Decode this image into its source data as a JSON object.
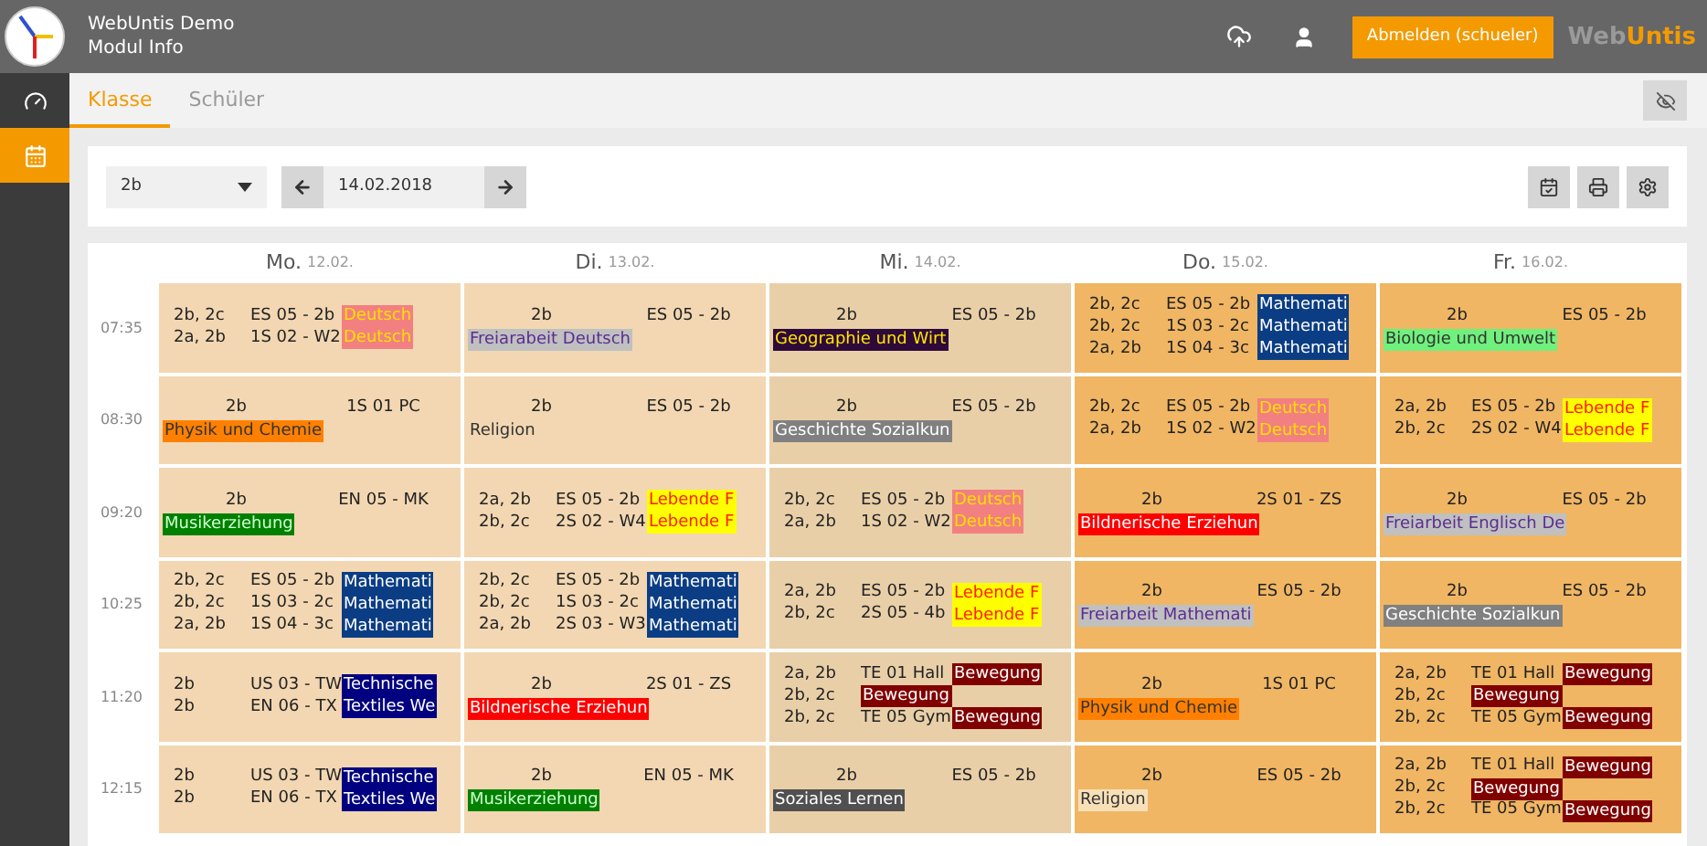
{
  "app": {
    "title": "WebUntis Demo",
    "subtitle": "Modul Info",
    "logout": "Abmelden (schueler)",
    "brand_prefix": "Web",
    "brand_suffix": "Untis"
  },
  "sidebar": [
    {
      "kind": "dashboard",
      "selected": false
    },
    {
      "kind": "calendar",
      "selected": true
    }
  ],
  "tabs": [
    {
      "label": "Klasse",
      "selected": true
    },
    {
      "label": "Schüler",
      "selected": false
    }
  ],
  "toolbar": {
    "class_select": "2b",
    "date": "14.02.2018"
  },
  "days": [
    {
      "name": "Mo.",
      "date": "12.02.",
      "color": "#f2d7b2"
    },
    {
      "name": "Di.",
      "date": "13.02.",
      "color": "#f2d7b2"
    },
    {
      "name": "Mi.",
      "date": "14.02.",
      "color": "#e9cfa8"
    },
    {
      "name": "Do.",
      "date": "15.02.",
      "color": "#f0b664"
    },
    {
      "name": "Fr.",
      "date": "16.02.",
      "color": "#f0b664"
    }
  ],
  "rows": [
    {
      "time": "07:35",
      "cells": [
        {
          "kind": "multi",
          "lines": [
            {
              "class": "2b, 2c",
              "room": "ES 05 - 2b",
              "subject": {
                "text": "Deutsch",
                "color": "#f28080"
              }
            },
            {
              "class": "2a, 2b",
              "room": "1S 02 - W2",
              "subject": {
                "text": "Deutsch",
                "color": "#f28080"
              }
            }
          ]
        },
        {
          "kind": "single",
          "class": "2b",
          "room": "ES 05 - 2b",
          "subject": {
            "text": "Freiarabeit Deutsch",
            "color": "#c0c0c0"
          }
        },
        {
          "kind": "single",
          "class": "2b",
          "room": "ES 05 - 2b",
          "subject": {
            "text": "Geographie und Wirt",
            "color": "#2e0a3a"
          }
        },
        {
          "kind": "multi",
          "lines": [
            {
              "class": "2b, 2c",
              "room": "ES 05 - 2b",
              "subject": {
                "text": "Mathemati",
                "color": "#0b3d84"
              }
            },
            {
              "class": "2b, 2c",
              "room": "1S 03 - 2c",
              "subject": {
                "text": "Mathemati",
                "color": "#0b3d84"
              }
            },
            {
              "class": "2a, 2b",
              "room": "1S 04 - 3c",
              "subject": {
                "text": "Mathemati",
                "color": "#0b3d84"
              }
            }
          ]
        },
        {
          "kind": "single",
          "class": "2b",
          "room": "ES 05 - 2b",
          "subject": {
            "text": "Biologie und Umwelt",
            "color": "#70f07c"
          }
        }
      ]
    },
    {
      "time": "08:30",
      "cells": [
        {
          "kind": "single",
          "class": "2b",
          "room": "1S 01 PC",
          "subject": {
            "text": "Physik und Chemie",
            "color": "#ff8000"
          }
        },
        {
          "kind": "single",
          "class": "2b",
          "room": "ES 05 - 2b",
          "subject": {
            "text": "Religion"
          }
        },
        {
          "kind": "single",
          "class": "2b",
          "room": "ES 05 - 2b",
          "subject": {
            "text": "Geschichte Sozialkun",
            "color": "#808080"
          }
        },
        {
          "kind": "multi",
          "lines": [
            {
              "class": "2b, 2c",
              "room": "ES 05 - 2b",
              "subject": {
                "text": "Deutsch",
                "color": "#f28080"
              }
            },
            {
              "class": "2a, 2b",
              "room": "1S 02 - W2",
              "subject": {
                "text": "Deutsch",
                "color": "#f28080"
              }
            }
          ]
        },
        {
          "kind": "multi",
          "lines": [
            {
              "class": "2a, 2b",
              "room": "ES 05 - 2b",
              "subject": {
                "text": "Lebende F",
                "color": "#ffff00"
              }
            },
            {
              "class": "2b, 2c",
              "room": "2S 02 - W4",
              "subject": {
                "text": "Lebende F",
                "color": "#ffff00"
              }
            }
          ]
        }
      ]
    },
    {
      "time": "09:20",
      "cells": [
        {
          "kind": "single",
          "class": "2b",
          "room": "EN 05 - MK",
          "subject": {
            "text": "Musikerziehung",
            "color": "#008000"
          }
        },
        {
          "kind": "multi",
          "lines": [
            {
              "class": "2a, 2b",
              "room": "ES 05 - 2b",
              "subject": {
                "text": "Lebende F",
                "color": "#ffff00"
              }
            },
            {
              "class": "2b, 2c",
              "room": "2S 02 - W4",
              "subject": {
                "text": "Lebende F",
                "color": "#ffff00"
              }
            }
          ]
        },
        {
          "kind": "multi",
          "lines": [
            {
              "class": "2b, 2c",
              "room": "ES 05 - 2b",
              "subject": {
                "text": "Deutsch",
                "color": "#f28080"
              }
            },
            {
              "class": "2a, 2b",
              "room": "1S 02 - W2",
              "subject": {
                "text": "Deutsch",
                "color": "#f28080"
              }
            }
          ]
        },
        {
          "kind": "single",
          "class": "2b",
          "room": "2S 01 - ZS",
          "subject": {
            "text": "Bildnerische Erziehun",
            "color": "#ff0000"
          }
        },
        {
          "kind": "single",
          "class": "2b",
          "room": "ES 05 - 2b",
          "subject": {
            "text": "Freiarbeit Englisch De",
            "color": "#c0c0c0"
          }
        }
      ]
    },
    {
      "time": "10:25",
      "cells": [
        {
          "kind": "multi",
          "lines": [
            {
              "class": "2b, 2c",
              "room": "ES 05 - 2b",
              "subject": {
                "text": "Mathemati",
                "color": "#0b3d84"
              }
            },
            {
              "class": "2b, 2c",
              "room": "1S 03 - 2c",
              "subject": {
                "text": "Mathemati",
                "color": "#0b3d84"
              }
            },
            {
              "class": "2a, 2b",
              "room": "1S 04 - 3c",
              "subject": {
                "text": "Mathemati",
                "color": "#0b3d84"
              }
            }
          ]
        },
        {
          "kind": "multi",
          "lines": [
            {
              "class": "2b, 2c",
              "room": "ES 05 - 2b",
              "subject": {
                "text": "Mathemati",
                "color": "#0b3d84"
              }
            },
            {
              "class": "2b, 2c",
              "room": "1S 03 - 2c",
              "subject": {
                "text": "Mathemati",
                "color": "#0b3d84"
              }
            },
            {
              "class": "2a, 2b",
              "room": "2S 03 - W3",
              "subject": {
                "text": "Mathemati",
                "color": "#0b3d84"
              }
            }
          ]
        },
        {
          "kind": "multi",
          "lines": [
            {
              "class": "2a, 2b",
              "room": "ES 05 - 2b",
              "subject": {
                "text": "Lebende F",
                "color": "#ffff00"
              }
            },
            {
              "class": "2b, 2c",
              "room": "2S 05 - 4b",
              "subject": {
                "text": "Lebende F",
                "color": "#ffff00"
              }
            }
          ]
        },
        {
          "kind": "single",
          "class": "2b",
          "room": "ES 05 - 2b",
          "subject": {
            "text": "Freiarbeit Mathemati",
            "color": "#c0c0c0"
          }
        },
        {
          "kind": "single",
          "class": "2b",
          "room": "ES 05 - 2b",
          "subject": {
            "text": "Geschichte Sozialkun",
            "color": "#808080"
          }
        }
      ]
    },
    {
      "time": "11:20",
      "cells": [
        {
          "kind": "multi",
          "lines": [
            {
              "class": "2b",
              "room": "US 03 - TW",
              "subject": {
                "text": "Technische",
                "color": "#000080"
              }
            },
            {
              "class": "2b",
              "room": "EN 06 - TX",
              "subject": {
                "text": "Textiles We",
                "color": "#000080"
              }
            }
          ]
        },
        {
          "kind": "single",
          "class": "2b",
          "room": "2S 01 - ZS",
          "subject": {
            "text": "Bildnerische Erziehun",
            "color": "#ff0000"
          }
        },
        {
          "kind": "multi",
          "lines": [
            {
              "class": "2a, 2b",
              "room": "TE 01 Hall",
              "subject": {
                "text": "Bewegung",
                "color": "#800000"
              }
            },
            {
              "class": "2b, 2c",
              "subject": {
                "text": "Bewegung",
                "color": "#800000"
              }
            },
            {
              "class": "2b, 2c",
              "room": "TE 05 Gym",
              "subject": {
                "text": "Bewegung",
                "color": "#800000"
              }
            }
          ]
        },
        {
          "kind": "single",
          "class": "2b",
          "room": "1S 01 PC",
          "subject": {
            "text": "Physik und Chemie",
            "color": "#ff8000"
          }
        },
        {
          "kind": "multi",
          "lines": [
            {
              "class": "2a, 2b",
              "room": "TE 01 Hall",
              "subject": {
                "text": "Bewegung",
                "color": "#800000"
              }
            },
            {
              "class": "2b, 2c",
              "subject": {
                "text": "Bewegung",
                "color": "#800000"
              }
            },
            {
              "class": "2b, 2c",
              "room": "TE 05 Gym",
              "subject": {
                "text": "Bewegung",
                "color": "#800000"
              }
            }
          ]
        }
      ]
    },
    {
      "time": "12:15",
      "cells": [
        {
          "kind": "multi",
          "lines": [
            {
              "class": "2b",
              "room": "US 03 - TW",
              "subject": {
                "text": "Technische",
                "color": "#000080"
              }
            },
            {
              "class": "2b",
              "room": "EN 06 - TX",
              "subject": {
                "text": "Textiles We",
                "color": "#000080"
              }
            }
          ]
        },
        {
          "kind": "single",
          "class": "2b",
          "room": "EN 05 - MK",
          "subject": {
            "text": "Musikerziehung",
            "color": "#008000"
          }
        },
        {
          "kind": "single",
          "class": "2b",
          "room": "ES 05 - 2b",
          "subject": {
            "text": "Soziales Lernen",
            "color": "#505050"
          }
        },
        {
          "kind": "single",
          "class": "2b",
          "room": "ES 05 - 2b",
          "subject": {
            "text": "Religion",
            "color": "#f7e0b8"
          }
        },
        {
          "kind": "multi",
          "lines": [
            {
              "class": "2a, 2b",
              "room": "TE 01 Hall",
              "subject": {
                "text": "Bewegung",
                "color": "#800000"
              }
            },
            {
              "class": "2b, 2c",
              "subject": {
                "text": "Bewegung",
                "color": "#800000"
              }
            },
            {
              "class": "2b, 2c",
              "room": "TE 05 Gym",
              "subject": {
                "text": "Bewegung",
                "color": "#800000"
              }
            }
          ]
        }
      ]
    }
  ]
}
